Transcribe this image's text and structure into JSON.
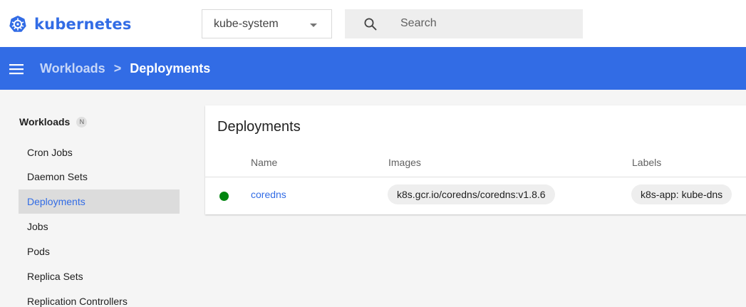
{
  "brand": {
    "name": "kubernetes",
    "logo_icon": "kubernetes-helm-wheel-icon",
    "color": "#326ce5"
  },
  "namespace_select": {
    "value": "kube-system"
  },
  "search": {
    "placeholder": "Search"
  },
  "header": {
    "background": "#326ce5",
    "breadcrumbs": [
      {
        "label": "Workloads"
      },
      {
        "separator": ">"
      },
      {
        "label": "Deployments"
      }
    ]
  },
  "sidebar": {
    "section_title": "Workloads",
    "section_badge": "N",
    "items": [
      {
        "label": "Cron Jobs",
        "active": false
      },
      {
        "label": "Daemon Sets",
        "active": false
      },
      {
        "label": "Deployments",
        "active": true
      },
      {
        "label": "Jobs",
        "active": false
      },
      {
        "label": "Pods",
        "active": false
      },
      {
        "label": "Replica Sets",
        "active": false
      },
      {
        "label": "Replication Controllers",
        "active": false
      }
    ]
  },
  "card": {
    "title": "Deployments",
    "columns": [
      "Name",
      "Images",
      "Labels"
    ],
    "rows": [
      {
        "status": "running",
        "status_color": "#00850f",
        "name": "coredns",
        "image": "k8s.gcr.io/coredns/coredns:v1.8.6",
        "label": "k8s-app: kube-dns"
      }
    ]
  }
}
